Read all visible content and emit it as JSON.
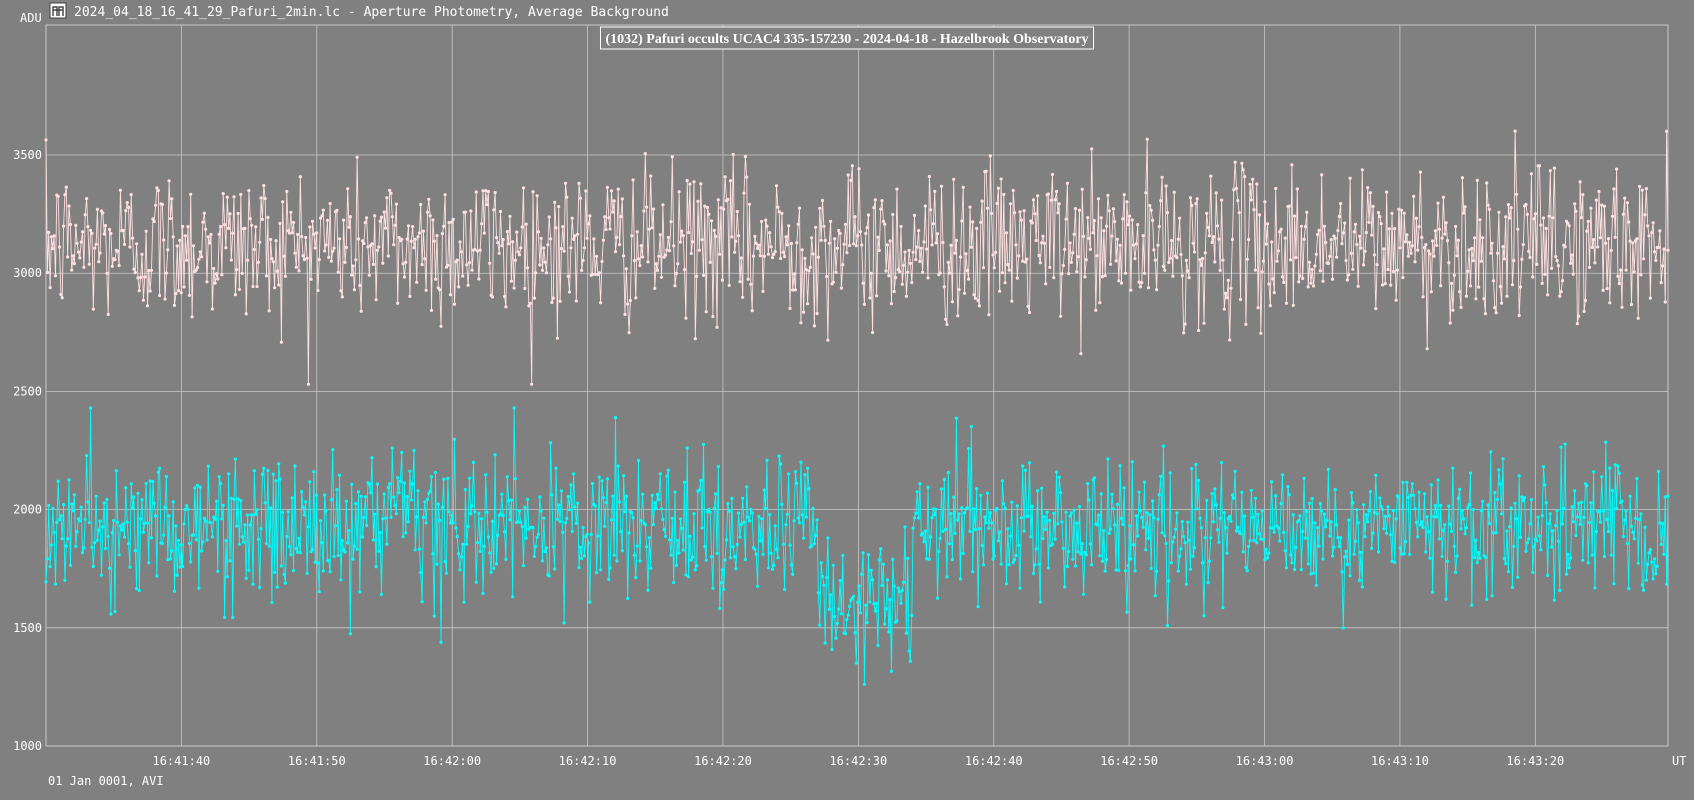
{
  "window": {
    "title": "2024_04_18_16_41_29_Pafuri_2min.lc - Aperture Photometry, Average Background",
    "icon": "tangra-app-icon"
  },
  "footer": {
    "date_note": "01 Jan 0001, AVI"
  },
  "colors": {
    "background": "#808080",
    "grid": "#c8c8c8",
    "target_series": "#00ffff",
    "comparison_series": "#ffe0e0",
    "text": "#ffffff"
  },
  "chart_data": {
    "type": "line",
    "title": "(1032) Pafuri occults UCAC4 335-157230 - 2024-04-18 - Hazelbrook Observatory",
    "ylabel": "ADU",
    "xlabel": "UT",
    "ylim": [
      1000,
      4050
    ],
    "xlim": [
      "16:41:30.0",
      "16:43:29.8"
    ],
    "yticks": [
      1000,
      1500,
      2000,
      2500,
      3000,
      3500
    ],
    "xticks": [
      "16:41:40",
      "16:41:50",
      "16:42:00",
      "16:42:10",
      "16:42:20",
      "16:42:30",
      "16:42:40",
      "16:42:50",
      "16:43:00",
      "16:43:10",
      "16:43:20"
    ],
    "grid": true,
    "legend": "none",
    "sampling": "~25 frames per second, 2 minute recording",
    "series": [
      {
        "role": "comparison",
        "color": "#ffe0e0",
        "mean": 3120,
        "scatter_sd": 160,
        "min_approx": 2530,
        "max_approx": 3800
      },
      {
        "role": "target",
        "color": "#00ffff",
        "baseline_mean": 1920,
        "scatter_sd": 150,
        "min_approx": 1250,
        "max_approx": 2430,
        "event": {
          "disappearance": "16:42:27.0",
          "reappearance": "16:42:34.0",
          "drop_level": 1580
        }
      }
    ]
  }
}
